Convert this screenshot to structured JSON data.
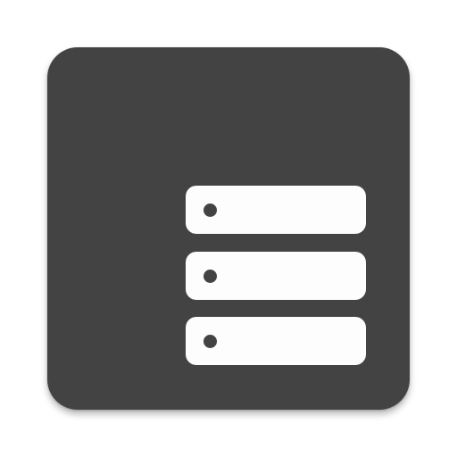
{
  "app_icon": {
    "icon_name": "server-storage-icon",
    "background_color": "#434343",
    "foreground_color": "#fdfdfd",
    "indicator_color": "#434343"
  },
  "server_units": [
    {
      "name": "server-unit-1"
    },
    {
      "name": "server-unit-2"
    },
    {
      "name": "server-unit-3"
    }
  ]
}
